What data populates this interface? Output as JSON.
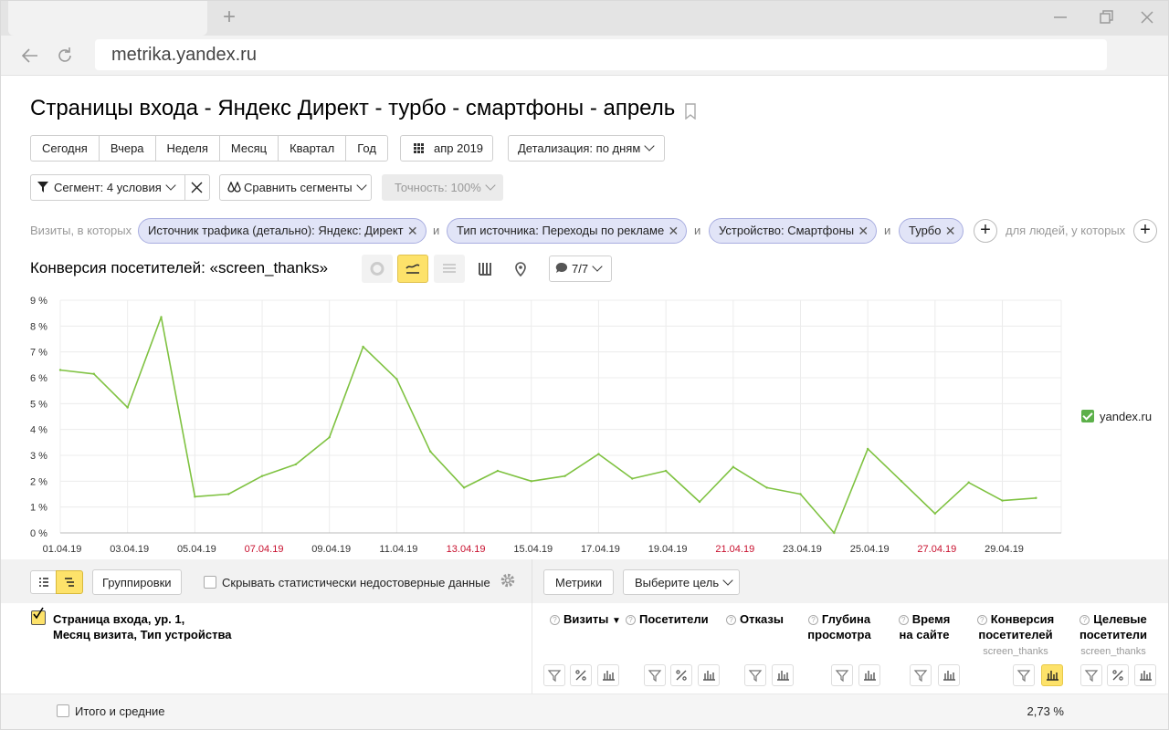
{
  "browser": {
    "url": "metrika.yandex.ru",
    "new_tab": "+"
  },
  "page": {
    "title": "Страницы входа - Яндекс Директ - турбо - смартфоны - апрель"
  },
  "period_buttons": [
    "Сегодня",
    "Вчера",
    "Неделя",
    "Месяц",
    "Квартал",
    "Год"
  ],
  "date_picker": "апр 2019",
  "detail": "Детализация: по дням",
  "segment": {
    "label": "Сегмент: 4 условия",
    "compare": "Сравнить сегменты",
    "accuracy": "Точность: 100%"
  },
  "filters": {
    "prefix": "Визиты, в которых",
    "chips": [
      "Источник трафика (детально): Яндекс: Директ",
      "Тип источника: Переходы по рекламе",
      "Устройство: Смартфоны",
      "Турбо"
    ],
    "connector": "и",
    "suffix": "для людей, у которых",
    "add": "+"
  },
  "chart_header": {
    "title": "Конверсия посетителей: «screen_thanks»",
    "annotations": "7/7"
  },
  "chart_data": {
    "type": "line",
    "x": [
      "01.04.19",
      "02.04.19",
      "03.04.19",
      "04.04.19",
      "05.04.19",
      "06.04.19",
      "07.04.19",
      "08.04.19",
      "09.04.19",
      "10.04.19",
      "11.04.19",
      "12.04.19",
      "13.04.19",
      "14.04.19",
      "15.04.19",
      "16.04.19",
      "17.04.19",
      "18.04.19",
      "19.04.19",
      "20.04.19",
      "21.04.19",
      "22.04.19",
      "23.04.19",
      "24.04.19",
      "25.04.19",
      "26.04.19",
      "27.04.19",
      "28.04.19",
      "29.04.19",
      "30.04.19"
    ],
    "series": [
      {
        "name": "yandex.ru",
        "color": "#7fc241",
        "values": [
          6.3,
          6.15,
          4.85,
          8.35,
          1.4,
          1.5,
          2.2,
          2.65,
          3.7,
          7.2,
          5.95,
          3.15,
          1.75,
          2.4,
          2.0,
          2.2,
          3.05,
          2.1,
          2.4,
          1.2,
          2.55,
          1.75,
          1.5,
          0.0,
          3.25,
          2.0,
          0.75,
          1.95,
          1.25,
          1.35
        ]
      }
    ],
    "x_tick_labels": [
      "01.04.19",
      "03.04.19",
      "05.04.19",
      "07.04.19",
      "09.04.19",
      "11.04.19",
      "13.04.19",
      "15.04.19",
      "17.04.19",
      "19.04.19",
      "21.04.19",
      "23.04.19",
      "25.04.19",
      "27.04.19",
      "29.04.19"
    ],
    "weekend_labels": [
      "07.04.19",
      "13.04.19",
      "21.04.19",
      "27.04.19"
    ],
    "y_ticks": [
      "0 %",
      "1 %",
      "2 %",
      "3 %",
      "4 %",
      "5 %",
      "6 %",
      "7 %",
      "8 %",
      "9 %"
    ],
    "ylim": [
      0,
      9
    ],
    "grid": true,
    "legend_position": "right"
  },
  "table": {
    "view_list": "list",
    "view_tree": "tree",
    "groupings": "Группировки",
    "hide_unreliable": "Скрывать статистически недостоверные данные",
    "metrics": "Метрики",
    "goal": "Выберите цель",
    "dim_header_line1": "Страница входа, ур. 1,",
    "dim_header_line2": "Месяц визита, Тип устройства",
    "columns": [
      {
        "l1": "Визиты",
        "l2": "",
        "sub": ""
      },
      {
        "l1": "Посетители",
        "l2": "",
        "sub": ""
      },
      {
        "l1": "Отказы",
        "l2": "",
        "sub": ""
      },
      {
        "l1": "Глубина",
        "l2": "просмотра",
        "sub": ""
      },
      {
        "l1": "Время",
        "l2": "на сайте",
        "sub": ""
      },
      {
        "l1": "Конверсия",
        "l2": "посетителей",
        "sub": "screen_thanks"
      },
      {
        "l1": "Целевые",
        "l2": "посетители",
        "sub": "screen_thanks"
      }
    ],
    "sort_marker": "▼",
    "total_label": "Итого и средние",
    "total_conversion": "2,73 %"
  }
}
